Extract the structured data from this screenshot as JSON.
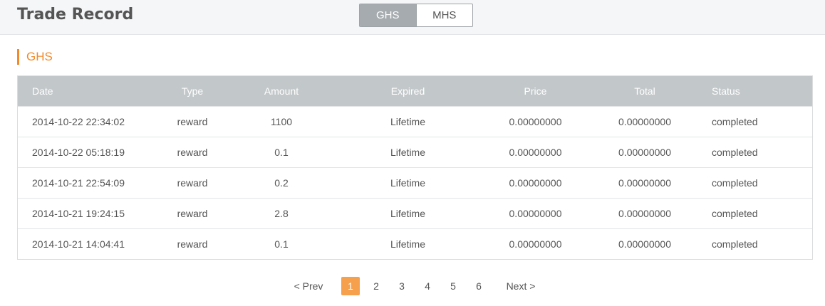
{
  "header": {
    "title": "Trade Record",
    "toggle": [
      {
        "label": "GHS",
        "active": true
      },
      {
        "label": "MHS",
        "active": false
      }
    ]
  },
  "section": {
    "title": "GHS"
  },
  "table": {
    "columns": [
      "Date",
      "Type",
      "Amount",
      "Expired",
      "Price",
      "Total",
      "Status"
    ],
    "rows": [
      [
        "2014-10-22 22:34:02",
        "reward",
        "1100",
        "Lifetime",
        "0.00000000",
        "0.00000000",
        "completed"
      ],
      [
        "2014-10-22 05:18:19",
        "reward",
        "0.1",
        "Lifetime",
        "0.00000000",
        "0.00000000",
        "completed"
      ],
      [
        "2014-10-21 22:54:09",
        "reward",
        "0.2",
        "Lifetime",
        "0.00000000",
        "0.00000000",
        "completed"
      ],
      [
        "2014-10-21 19:24:15",
        "reward",
        "2.8",
        "Lifetime",
        "0.00000000",
        "0.00000000",
        "completed"
      ],
      [
        "2014-10-21 14:04:41",
        "reward",
        "0.1",
        "Lifetime",
        "0.00000000",
        "0.00000000",
        "completed"
      ]
    ]
  },
  "pager": {
    "prev": "< Prev",
    "next": "Next >",
    "pages": [
      "1",
      "2",
      "3",
      "4",
      "5",
      "6"
    ],
    "current": "1"
  },
  "colors": {
    "accent": "#f08a2a",
    "active_page": "#f6a04d",
    "table_header": "#c2c7c9",
    "toggle_active": "#a6abaf"
  }
}
